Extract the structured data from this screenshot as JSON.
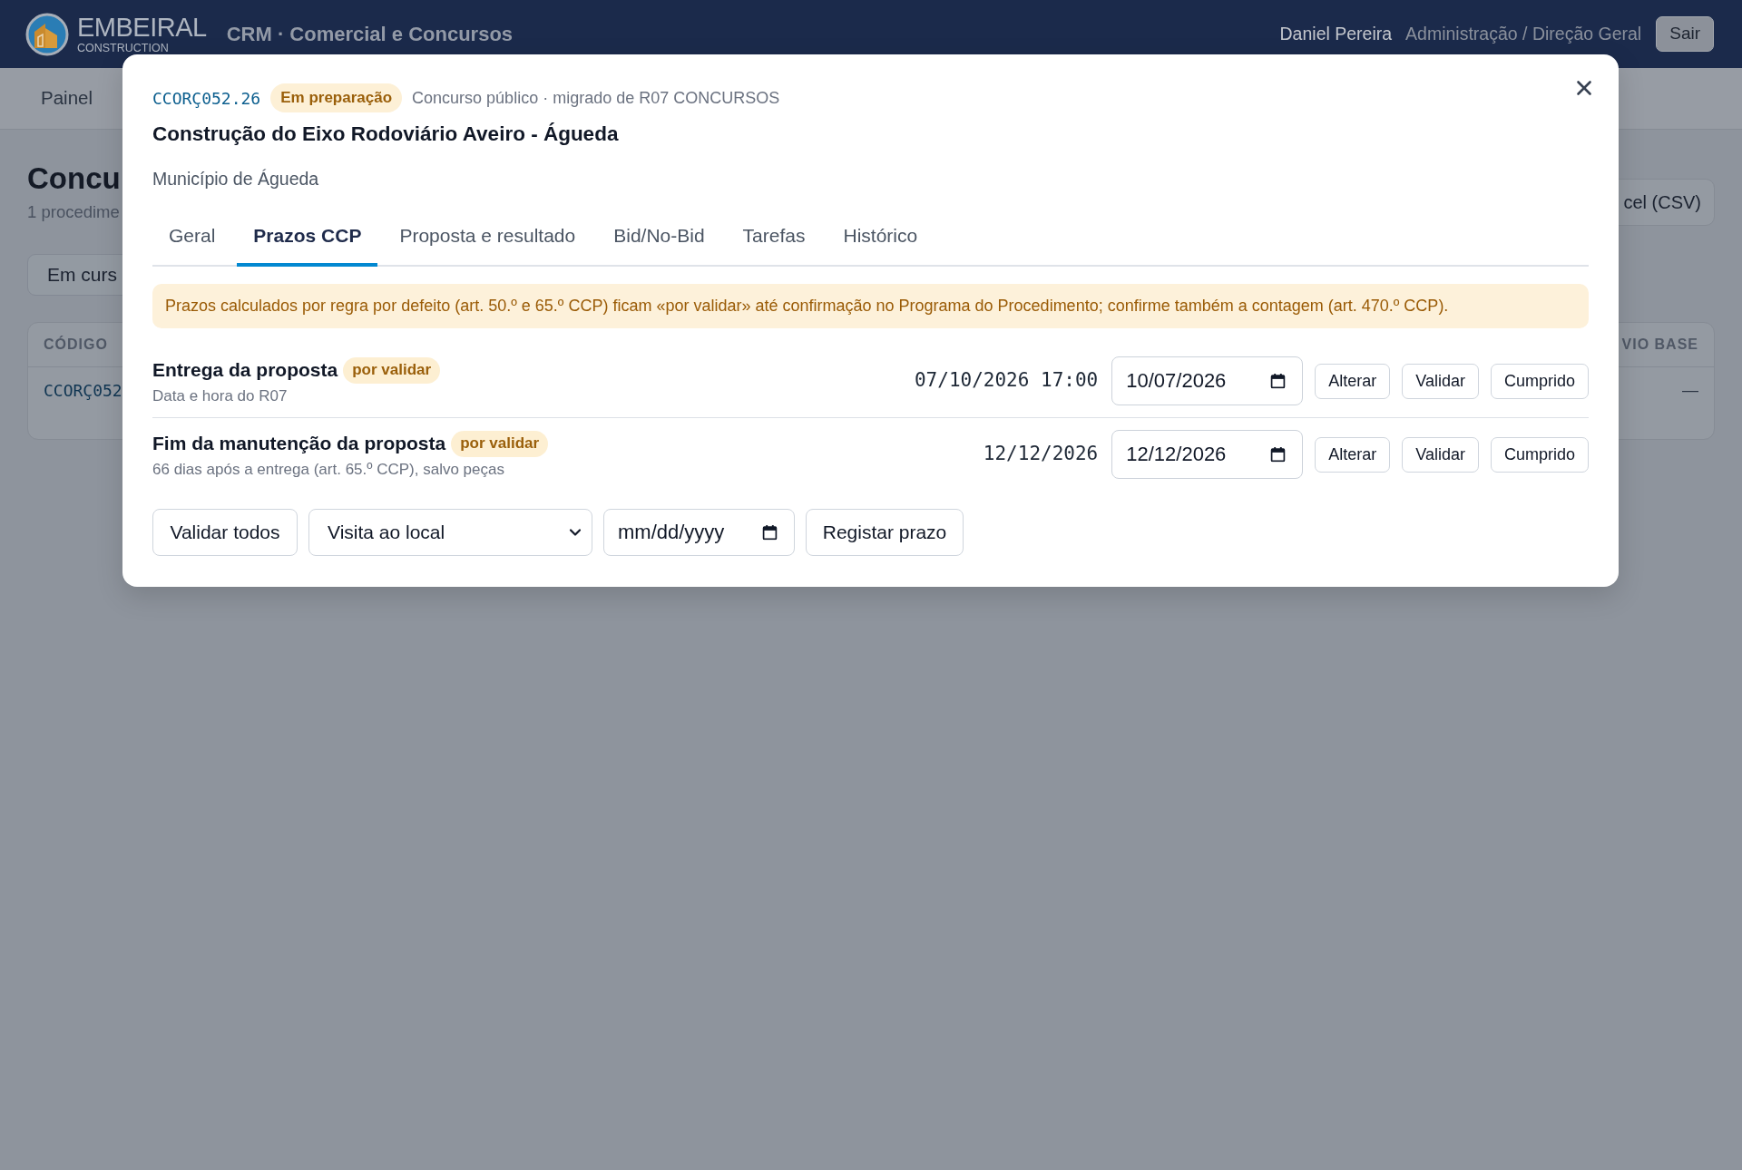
{
  "header": {
    "logo": {
      "name": "EMBEIRAL",
      "tagline": "CONSTRUCTION"
    },
    "app_title": "CRM · Comercial e Concursos",
    "user": "Daniel Pereira",
    "role": "Administração / Direção Geral",
    "logout_button": "Sair"
  },
  "nav": {
    "items": [
      "Painel"
    ]
  },
  "page": {
    "title": "Concu",
    "subtitle": "1 procedime",
    "filter": "Em curs",
    "export_button": "cel (CSV)",
    "table": {
      "columns": [
        "CÓDIGO",
        "VIO BASE"
      ],
      "rows": [
        [
          "CCORÇ052",
          "—"
        ]
      ]
    }
  },
  "modal": {
    "code": "CCORÇ052.26",
    "status_badge": "Em preparação",
    "meta": "Concurso público · migrado de R07 CONCURSOS",
    "title": "Construção do Eixo Rodoviário Aveiro - Águeda",
    "entity": "Município de Águeda",
    "tabs": [
      {
        "label": "Geral",
        "selected": false
      },
      {
        "label": "Prazos CCP",
        "selected": true
      },
      {
        "label": "Proposta e resultado",
        "selected": false
      },
      {
        "label": "Bid/No-Bid",
        "selected": false
      },
      {
        "label": "Tarefas",
        "selected": false
      },
      {
        "label": "Histórico",
        "selected": false
      }
    ],
    "notice": "Prazos calculados por regra por defeito (art. 50.º e 65.º CCP) ficam «por validar» até confirmação no Programa do Procedimento; confirme também a contagem (art. 470.º CCP).",
    "deadlines": [
      {
        "name": "Entrega da proposta",
        "badge": "por validar",
        "note": "Data e hora do R07",
        "computed": "07/10/2026 17:00",
        "date_value": "10/07/2026",
        "actions": [
          "Alterar",
          "Validar",
          "Cumprido"
        ]
      },
      {
        "name": "Fim da manutenção da proposta",
        "badge": "por validar",
        "note": "66 dias após a entrega (art. 65.º CCP), salvo peças",
        "computed": "12/12/2026",
        "date_value": "12/12/2026",
        "actions": [
          "Alterar",
          "Validar",
          "Cumprido"
        ]
      }
    ],
    "footer": {
      "validate_all_button": "Validar todos",
      "type_select": "Visita ao local",
      "date_field": {
        "placeholder": "mm/dd/yyyy"
      },
      "register_button": "Registar prazo"
    }
  }
}
